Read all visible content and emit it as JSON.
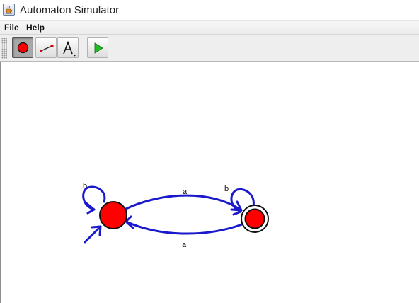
{
  "window": {
    "title": "Automaton Simulator",
    "app_icon": "java-cup-icon"
  },
  "menu": {
    "items": [
      {
        "label": "File"
      },
      {
        "label": "Help"
      }
    ]
  },
  "toolbar": {
    "tools": [
      {
        "name": "state-tool",
        "icon": "red-circle-icon",
        "selected": true
      },
      {
        "name": "transition-tool",
        "icon": "transition-line-icon",
        "selected": false
      },
      {
        "name": "text-tool",
        "icon": "text-a-icon",
        "selected": false
      },
      {
        "name": "run-tool",
        "icon": "green-play-icon",
        "selected": false
      }
    ]
  },
  "colors": {
    "state_fill": "#ff0000",
    "transition": "#1a1acc",
    "run": "#22bb22"
  },
  "automaton": {
    "states": [
      {
        "id": "q0",
        "initial": true,
        "accepting": false
      },
      {
        "id": "q1",
        "initial": false,
        "accepting": true
      }
    ],
    "transitions": [
      {
        "from": "q0",
        "to": "q0",
        "label": "b"
      },
      {
        "from": "q0",
        "to": "q1",
        "label": "a"
      },
      {
        "from": "q1",
        "to": "q0",
        "label": "a"
      },
      {
        "from": "q1",
        "to": "q1",
        "label": "b"
      }
    ]
  }
}
